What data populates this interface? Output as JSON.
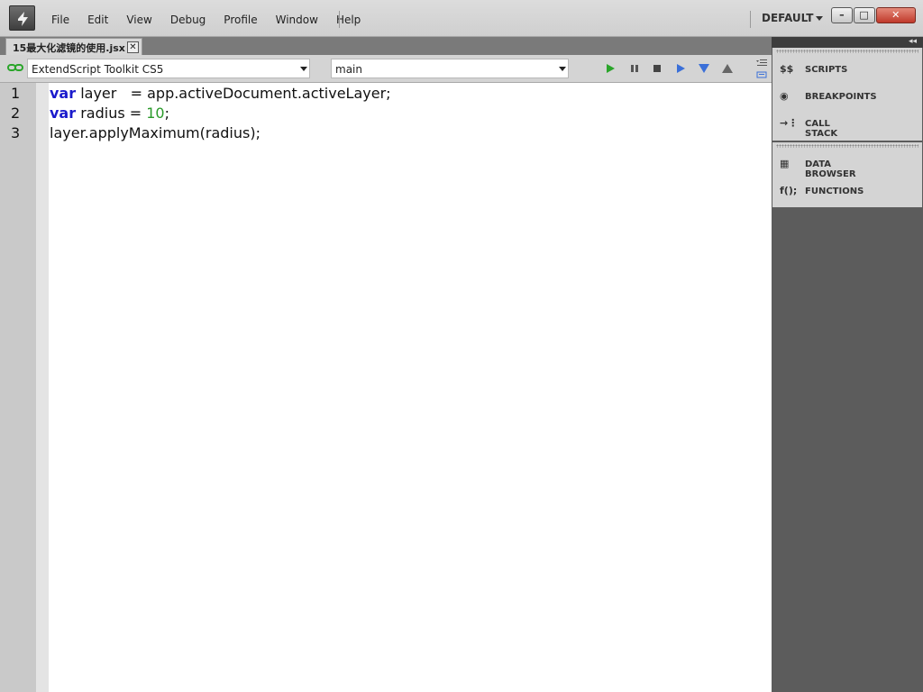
{
  "menubar": {
    "items": [
      "File",
      "Edit",
      "View",
      "Debug",
      "Profile",
      "Window",
      "Help"
    ],
    "workspace": "DEFAULT"
  },
  "window_buttons": {
    "minimize": "–",
    "restore": "□",
    "close": "✕"
  },
  "document_tab": {
    "title": "15最大化滤镜的使用.jsx",
    "close": "✕"
  },
  "toolbar": {
    "target_app": "ExtendScript Toolkit CS5",
    "function": "main"
  },
  "editor": {
    "lines": [
      {
        "number": "1",
        "tokens": [
          {
            "kind": "kw",
            "text": "var"
          },
          {
            "kind": "plain",
            "text": " layer   = app.activeDocument.activeLayer;"
          }
        ]
      },
      {
        "number": "2",
        "tokens": [
          {
            "kind": "kw",
            "text": "var"
          },
          {
            "kind": "plain",
            "text": " radius = "
          },
          {
            "kind": "num",
            "text": "10"
          },
          {
            "kind": "plain",
            "text": ";"
          }
        ]
      },
      {
        "number": "3",
        "tokens": [
          {
            "kind": "plain",
            "text": "layer.applyMaximum(radius);"
          }
        ]
      }
    ]
  },
  "right_panel": {
    "collapse_label": "◂◂",
    "group1": [
      {
        "label": "SCRIPTS",
        "icon": "scripts-icon",
        "glyph": "$$"
      },
      {
        "label": "BREAKPOINTS",
        "icon": "breakpoints-icon",
        "glyph": "◉"
      },
      {
        "label": "CALL STACK",
        "icon": "call-stack-icon",
        "glyph": "→⋮"
      }
    ],
    "group2": [
      {
        "label": "DATA BROWSER",
        "icon": "data-browser-icon",
        "glyph": "▦"
      },
      {
        "label": "FUNCTIONS",
        "icon": "functions-icon",
        "glyph": "f();"
      }
    ]
  },
  "colors": {
    "keyword": "#1a1acc",
    "number": "#2a9a2a",
    "run": "#2aa52a",
    "step": "#3a6fd8"
  }
}
